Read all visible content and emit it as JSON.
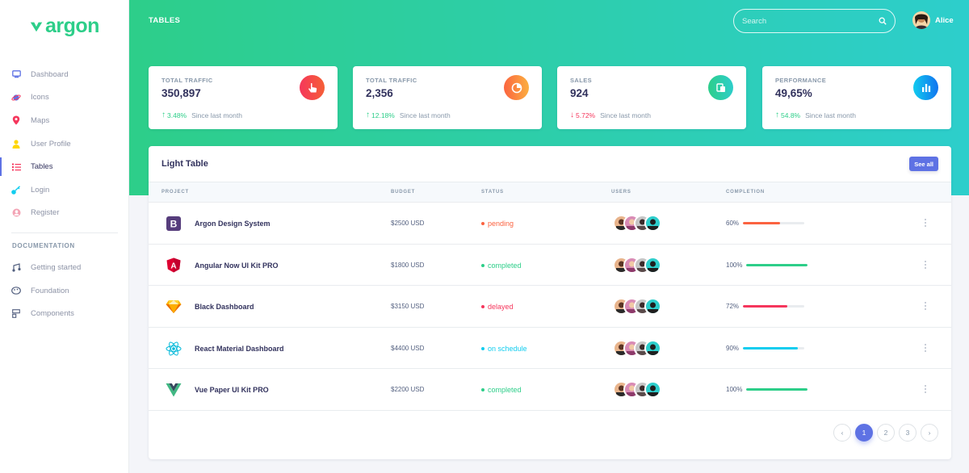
{
  "brand": {
    "name": "argon"
  },
  "sidebar": {
    "items": [
      {
        "label": "Dashboard",
        "icon": "tv-icon",
        "color": "#5e72e4"
      },
      {
        "label": "Icons",
        "icon": "planet-icon",
        "color": "#5e72e4"
      },
      {
        "label": "Maps",
        "icon": "pin-icon",
        "color": "#f5365c"
      },
      {
        "label": "User Profile",
        "icon": "user-icon",
        "color": "#ffd600"
      },
      {
        "label": "Tables",
        "icon": "bullet-list-icon",
        "color": "#f5365c"
      },
      {
        "label": "Login",
        "icon": "key-icon",
        "color": "#11cdef"
      },
      {
        "label": "Register",
        "icon": "circle-user-icon",
        "color": "#f3a4b5"
      }
    ],
    "active": "Tables",
    "doc_heading": "DOCUMENTATION",
    "docs": [
      {
        "label": "Getting started",
        "icon": "spaceship-icon"
      },
      {
        "label": "Foundation",
        "icon": "palette-icon"
      },
      {
        "label": "Components",
        "icon": "ui-components-icon"
      }
    ]
  },
  "header": {
    "title": "TABLES",
    "search_placeholder": "Search",
    "user_name": "Alice"
  },
  "stats": [
    {
      "title": "TOTAL TRAFFIC",
      "value": "350,897",
      "change": "3.48%",
      "direction": "up",
      "since": "Since last month",
      "icon": "hand-pointer-icon",
      "bg": "linear-gradient(87deg,#f5365c,#f56036)"
    },
    {
      "title": "TOTAL TRAFFIC",
      "value": "2,356",
      "change": "12.18%",
      "direction": "up",
      "since": "Since last month",
      "icon": "pie-chart-icon",
      "bg": "linear-gradient(87deg,#fb6340,#fbb140)"
    },
    {
      "title": "SALES",
      "value": "924",
      "change": "5.72%",
      "direction": "down",
      "since": "Since last month",
      "icon": "money-coins-icon",
      "bg": "linear-gradient(87deg,#2dce89,#2dcecc)"
    },
    {
      "title": "PERFORMANCE",
      "value": "49,65%",
      "change": "54.8%",
      "direction": "up",
      "since": "Since last month",
      "icon": "bar-chart-icon",
      "bg": "linear-gradient(87deg,#11cdef,#1171ef)"
    }
  ],
  "table": {
    "title": "Light Table",
    "see_all": "See all",
    "columns": [
      "PROJECT",
      "BUDGET",
      "STATUS",
      "USERS",
      "COMPLETION"
    ],
    "rows": [
      {
        "project": "Argon Design System",
        "logo": "bootstrap-logo-icon",
        "budget": "$2500 USD",
        "status": "pending",
        "status_color": "#fb6340",
        "completion": "60%",
        "pct": 60,
        "bar_color": "#fb6340"
      },
      {
        "project": "Angular Now UI Kit PRO",
        "logo": "angular-logo-icon",
        "budget": "$1800 USD",
        "status": "completed",
        "status_color": "#2dce89",
        "completion": "100%",
        "pct": 100,
        "bar_color": "#2dce89"
      },
      {
        "project": "Black Dashboard",
        "logo": "sketch-logo-icon",
        "budget": "$3150 USD",
        "status": "delayed",
        "status_color": "#f5365c",
        "completion": "72%",
        "pct": 72,
        "bar_color": "#f5365c"
      },
      {
        "project": "React Material Dashboard",
        "logo": "react-logo-icon",
        "budget": "$4400 USD",
        "status": "on schedule",
        "status_color": "#11cdef",
        "completion": "90%",
        "pct": 90,
        "bar_color": "#11cdef"
      },
      {
        "project": "Vue Paper UI Kit PRO",
        "logo": "vue-logo-icon",
        "budget": "$2200 USD",
        "status": "completed",
        "status_color": "#2dce89",
        "completion": "100%",
        "pct": 100,
        "bar_color": "#2dce89"
      }
    ]
  },
  "pagination": {
    "prev": "‹",
    "pages": [
      "1",
      "2",
      "3"
    ],
    "active": "1",
    "next": "›"
  }
}
